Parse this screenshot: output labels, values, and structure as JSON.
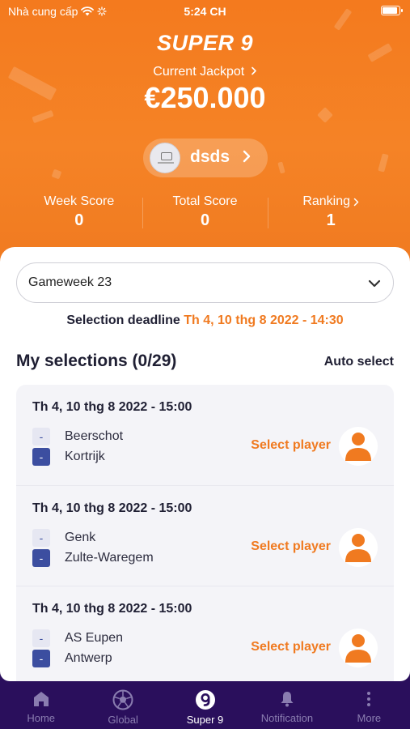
{
  "status_bar": {
    "carrier": "Nhà cung cấp",
    "time": "5:24 CH",
    "battery_level": 0.95
  },
  "header": {
    "app_title": "SUPER 9",
    "jackpot_label": "Current Jackpot",
    "jackpot_value": "€250.000"
  },
  "team": {
    "name": "dsds",
    "icon": "chevron-right-icon"
  },
  "stats": [
    {
      "label": "Week Score",
      "value": "0"
    },
    {
      "label": "Total Score",
      "value": "0"
    },
    {
      "label": "Ranking",
      "value": "1"
    }
  ],
  "gameweek": {
    "selected": "Gameweek 23",
    "icon": "chevron-down-icon"
  },
  "deadline": {
    "label": "Selection deadline",
    "value": "Th 4, 10 thg 8 2022 - 14:30"
  },
  "selections": {
    "title": "My selections (0/29)",
    "auto_select_label": "Auto select"
  },
  "matches": [
    {
      "date": "Th 4, 10 thg 8 2022 - 15:00",
      "home": "Beerschot",
      "away": "Kortrijk",
      "home_score": "-",
      "away_score": "-",
      "action": "Select player"
    },
    {
      "date": "Th 4, 10 thg 8 2022 - 15:00",
      "home": "Genk",
      "away": "Zulte-Waregem",
      "home_score": "-",
      "away_score": "-",
      "action": "Select player"
    },
    {
      "date": "Th 4, 10 thg 8 2022 - 15:00",
      "home": "AS Eupen",
      "away": "Antwerp",
      "home_score": "-",
      "away_score": "-",
      "action": "Select player"
    }
  ],
  "tabbar": {
    "items": [
      {
        "label": "Home",
        "icon": "home-icon"
      },
      {
        "label": "Global",
        "icon": "soccer-ball-icon"
      },
      {
        "label": "Super 9",
        "icon": "super9-icon"
      },
      {
        "label": "Notification",
        "icon": "bell-icon"
      },
      {
        "label": "More",
        "icon": "more-vertical-icon"
      }
    ],
    "active": "Super 9"
  },
  "colors": {
    "accent": "#f07a20",
    "header_bg": "#f47a1e",
    "tabbar_bg": "#2a0f5c",
    "score_blue": "#3c4ea0",
    "text_dark": "#1f1f33"
  }
}
